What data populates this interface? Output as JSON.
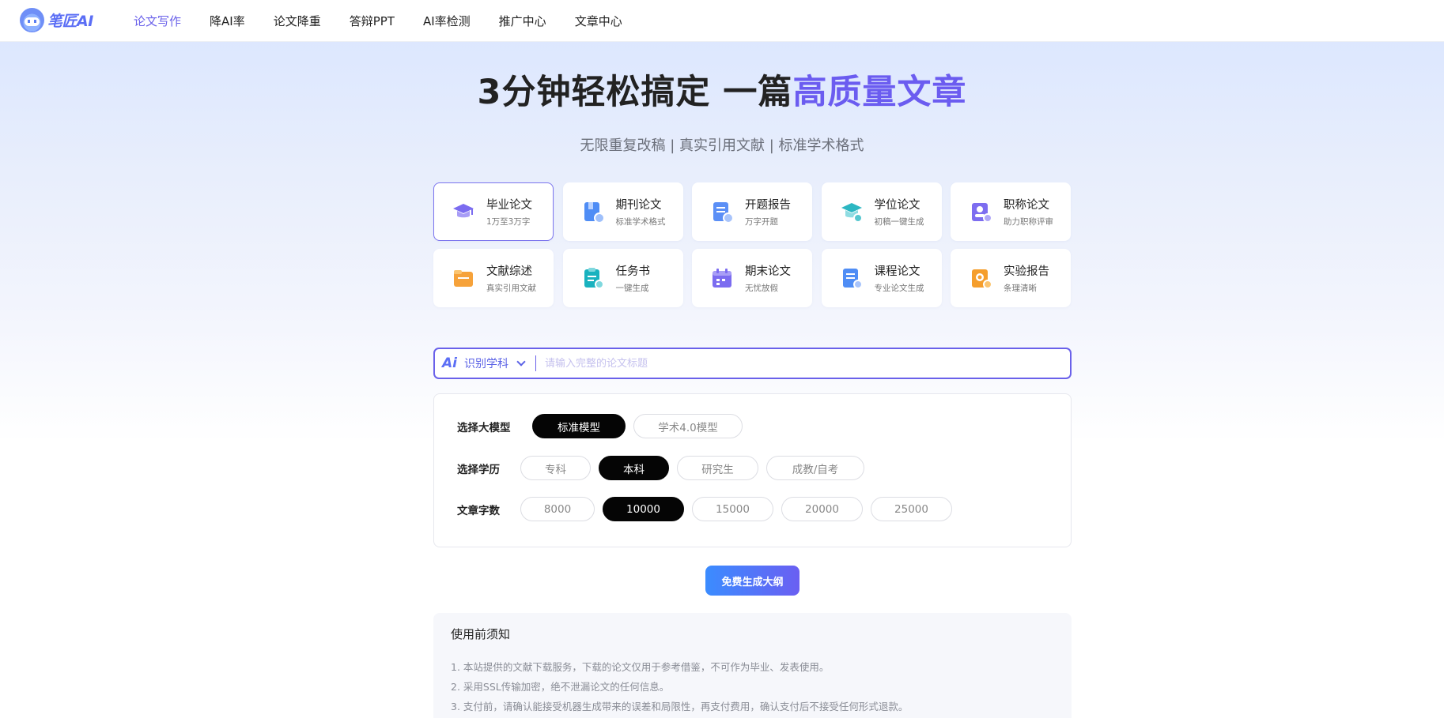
{
  "brand": {
    "name": "笔匠AI"
  },
  "nav": {
    "items": [
      {
        "label": "论文写作",
        "active": true
      },
      {
        "label": "降AI率"
      },
      {
        "label": "论文降重"
      },
      {
        "label": "答辩PPT"
      },
      {
        "label": "AI率检测"
      },
      {
        "label": "推广中心"
      },
      {
        "label": "文章中心"
      }
    ]
  },
  "hero": {
    "title_main": "3分钟轻松搞定 一篇",
    "title_accent": "高质量文章",
    "subtitle": "无限重复改稿 | 真实引用文献 | 标准学术格式"
  },
  "paper_types": [
    {
      "title": "毕业论文",
      "desc": "1万至3万字",
      "icon": "graduation-cap-icon",
      "color": "#7b6cf0",
      "selected": true
    },
    {
      "title": "期刊论文",
      "desc": "标准学术格式",
      "icon": "journal-book-icon",
      "color": "#4f8df5"
    },
    {
      "title": "开题报告",
      "desc": "万字开题",
      "icon": "report-doc-icon",
      "color": "#5b8ff6"
    },
    {
      "title": "学位论文",
      "desc": "初稿一键生成",
      "icon": "degree-cap-icon",
      "color": "#2cb7c2"
    },
    {
      "title": "职称论文",
      "desc": "助力职称评审",
      "icon": "title-badge-icon",
      "color": "#7d6df0"
    },
    {
      "title": "文献综述",
      "desc": "真实引用文献",
      "icon": "literature-folder-icon",
      "color": "#f6a23a"
    },
    {
      "title": "任务书",
      "desc": "一键生成",
      "icon": "task-clipboard-icon",
      "color": "#19b2bf"
    },
    {
      "title": "期末论文",
      "desc": "无忧放假",
      "icon": "calendar-icon",
      "color": "#7b6cf0"
    },
    {
      "title": "课程论文",
      "desc": "专业论文生成",
      "icon": "course-doc-icon",
      "color": "#4f8df5"
    },
    {
      "title": "实验报告",
      "desc": "条理清晰",
      "icon": "lab-report-icon",
      "color": "#f59e2c"
    }
  ],
  "title_input": {
    "ai_badge": "Ai",
    "subject_label": "识别学科",
    "placeholder": "请输入完整的论文标题",
    "value": ""
  },
  "options": {
    "model": {
      "label": "选择大模型",
      "choices": [
        "标准模型",
        "学术4.0模型"
      ],
      "selected": "标准模型"
    },
    "education": {
      "label": "选择学历",
      "choices": [
        "专科",
        "本科",
        "研究生",
        "成教/自考"
      ],
      "selected": "本科"
    },
    "word_count": {
      "label": "文章字数",
      "choices": [
        "8000",
        "10000",
        "15000",
        "20000",
        "25000"
      ],
      "selected": "10000"
    }
  },
  "generate_button": {
    "label": "免费生成大纲"
  },
  "notice": {
    "title": "使用前须知",
    "items": [
      "1. 本站提供的文献下载服务，下载的论文仅用于参考借鉴，不可作为毕业、发表使用。",
      "2. 采用SSL传输加密，绝不泄漏论文的任何信息。",
      "3. 支付前，请确认能接受机器生成带来的误差和局限性，再支付费用，确认支付后不接受任何形式退款。"
    ]
  }
}
